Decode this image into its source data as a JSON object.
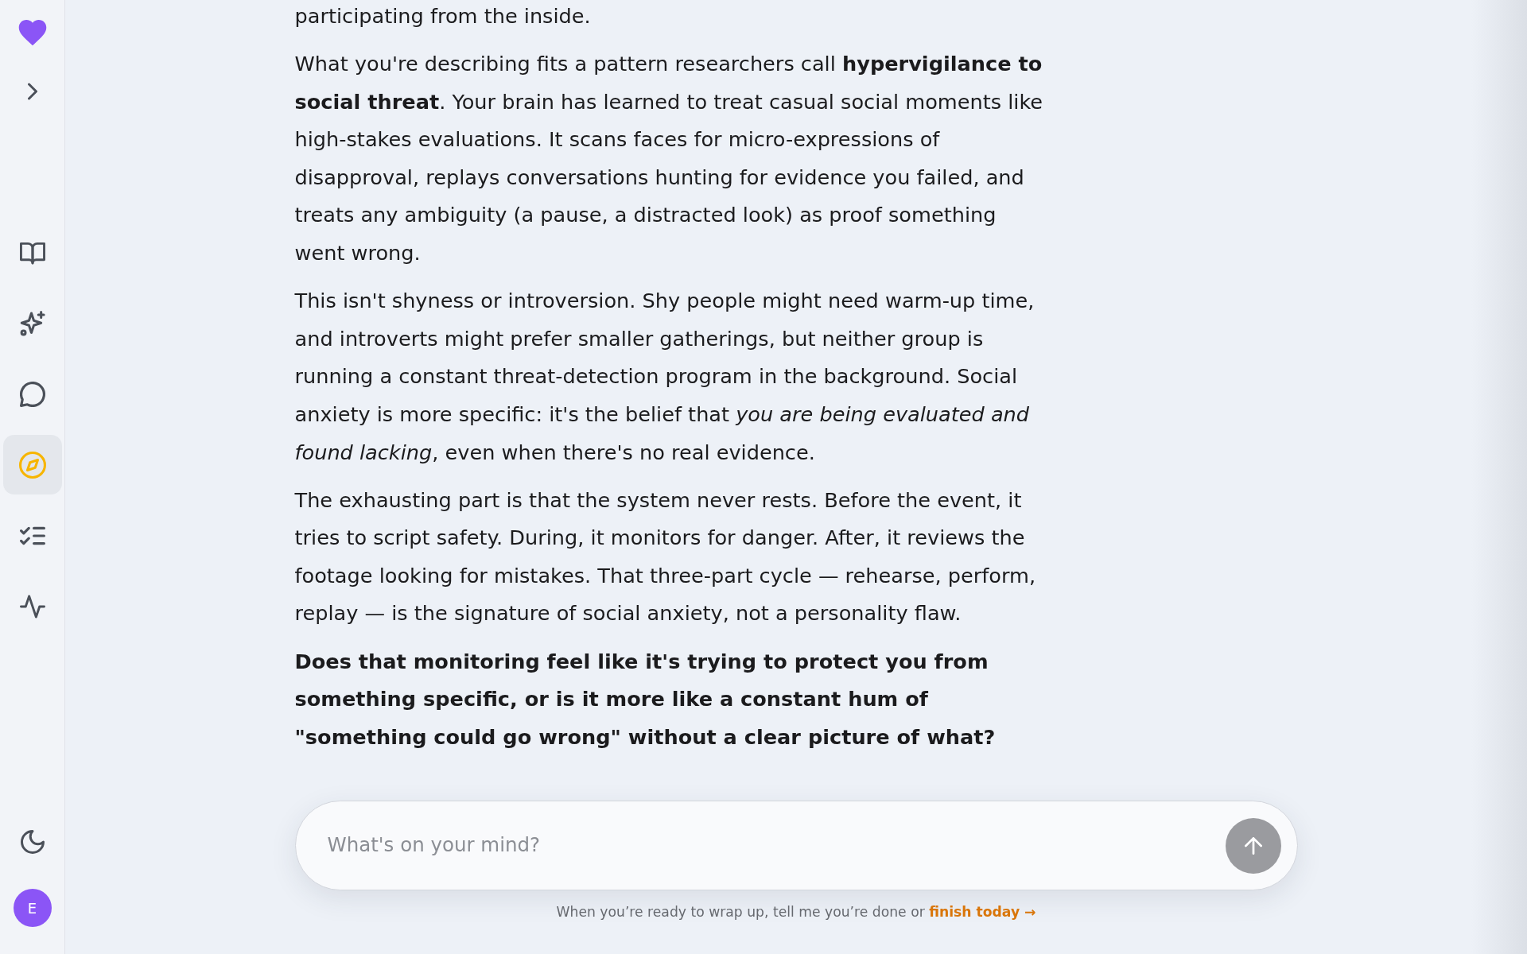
{
  "sidebar": {
    "nav_items": [
      {
        "selected": false
      },
      {
        "selected": false
      },
      {
        "selected": false
      },
      {
        "selected": true
      },
      {
        "selected": false
      },
      {
        "selected": false
      }
    ],
    "user": {
      "initial": "E"
    }
  },
  "conversation": {
    "paragraphs": [
      {
        "kind": "text",
        "text": "participating from the inside."
      },
      {
        "kind": "text",
        "text": "What you're describing fits a pattern researchers call **hypervigilance to social threat**. Your brain has learned to treat casual social moments like high-stakes evaluations. It scans faces for micro-expressions of disapproval, replays conversations hunting for evidence you failed, and treats any ambiguity (a pause, a distracted look) as proof something went wrong."
      },
      {
        "kind": "text",
        "text": "This isn't shyness or introversion. Shy people might need warm-up time, and introverts might prefer smaller gatherings, but neither group is running a constant threat-detection program in the background. Social anxiety is more specific: it's the belief that *you are being evaluated and found lacking*, even when there's no real evidence."
      },
      {
        "kind": "text",
        "text": "The exhausting part is that the system never rests. Before the event, it tries to script safety. During, it monitors for danger. After, it reviews the footage looking for mistakes. That three-part cycle — rehearse, perform, replay — is the signature of social anxiety, not a personality flaw."
      },
      {
        "kind": "question",
        "text": "Does that monitoring feel like it's trying to protect you from something specific, or is it more like a constant hum of \"something could go wrong\" without a clear picture of what?"
      }
    ]
  },
  "composer": {
    "placeholder": "What's on your mind?",
    "send_button": {
      "disabled": true
    },
    "hint": "When you’re ready to wrap up, tell me you’re done or",
    "link": "finish today →"
  }
}
